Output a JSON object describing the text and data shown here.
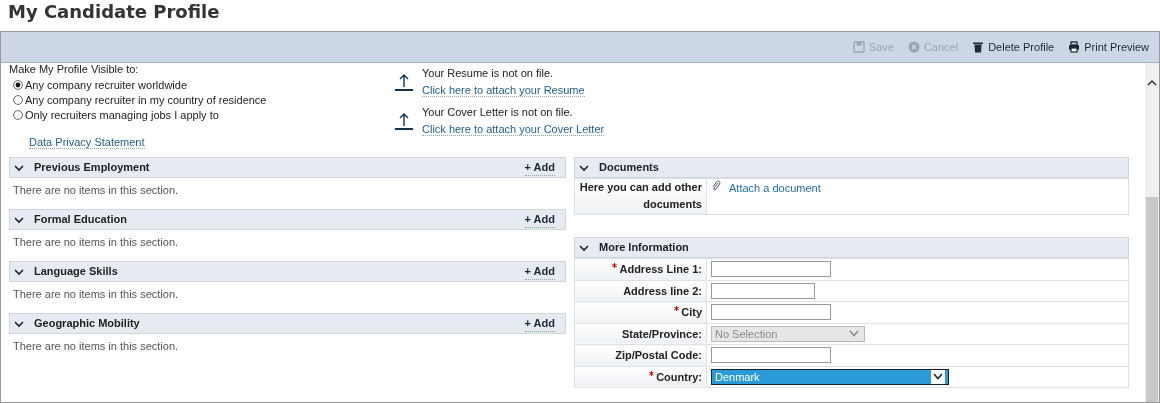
{
  "page_title": "My Candidate Profile",
  "toolbar": [
    {
      "label": "Save",
      "disabled": true
    },
    {
      "label": "Cancel",
      "disabled": true
    },
    {
      "label": "Delete Profile",
      "disabled": false
    },
    {
      "label": "Print Preview",
      "disabled": false
    }
  ],
  "visibility": {
    "label": "Make My Profile Visible to:",
    "options": [
      {
        "label": "Any company recruiter worldwide",
        "selected": true
      },
      {
        "label": "Any company recruiter in my country of residence",
        "selected": false
      },
      {
        "label": "Only recruiters managing jobs I apply to",
        "selected": false
      }
    ],
    "privacy_link": "Data Privacy Statement"
  },
  "attachments": [
    {
      "status": "Your Resume is not on file.",
      "link": "Click here to attach your Resume"
    },
    {
      "status": "Your Cover Letter is not on file.",
      "link": "Click here to attach your Cover Letter"
    }
  ],
  "sections": [
    {
      "title": "Previous Employment",
      "expanded": true,
      "add": "+ Add",
      "empty": "There are no items in this section."
    },
    {
      "title": "Formal Education",
      "expanded": true,
      "add": "+ Add",
      "empty": "There are no items in this section."
    },
    {
      "title": "Language Skills",
      "expanded": true,
      "add": "+ Add",
      "empty": "There are no items in this section."
    },
    {
      "title": "Geographic Mobility",
      "expanded": true,
      "add": "+ Add",
      "empty": "There are no items in this section."
    }
  ],
  "documents": {
    "title": "Documents",
    "expanded": true,
    "label": "Here you can add other documents",
    "link": "Attach a document"
  },
  "more_information": {
    "title": "More Information",
    "expanded": true,
    "fields": [
      {
        "label": "Address Line 1:",
        "required": true,
        "kind": "text"
      },
      {
        "label": "Address line 2:",
        "required": false,
        "kind": "text"
      },
      {
        "label": "City",
        "required": true,
        "kind": "text"
      },
      {
        "label": "State/Province:",
        "required": false,
        "kind": "select",
        "value": "No Selection",
        "disabled": true,
        "focused": false
      },
      {
        "label": "Zip/Postal Code:",
        "required": false,
        "kind": "text"
      },
      {
        "label": "Country:",
        "required": true,
        "kind": "select",
        "value": "Denmark",
        "disabled": false,
        "focused": true
      }
    ]
  }
}
